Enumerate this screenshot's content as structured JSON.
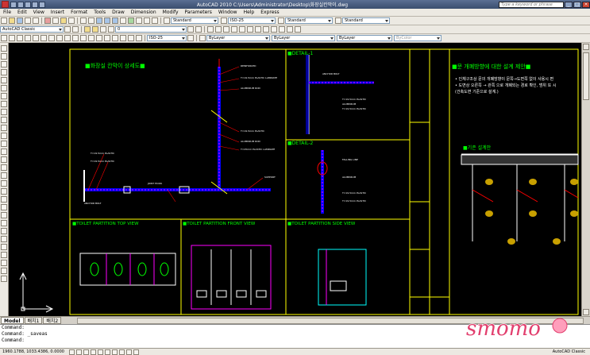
{
  "window": {
    "title": "AutoCAD 2010  C:\\Users\\Administrator\\Desktop\\화장실칸막이.dwg",
    "search_placeholder": "Type a keyword or phrase"
  },
  "menu": [
    "File",
    "Edit",
    "View",
    "Insert",
    "Format",
    "Tools",
    "Draw",
    "Dimension",
    "Modify",
    "Parameters",
    "Window",
    "Help",
    "Express"
  ],
  "toolbar1": {
    "textstyle": "Standard",
    "dimstyle": "ISO-25",
    "tablestyle": "Standard",
    "mleaderstyle": "Standard"
  },
  "toolbar2": {
    "workspace": "AutoCAD Classic",
    "layer": "0"
  },
  "toolbar3": {
    "dimstyle2": "ISO-25",
    "color": "ByLayer",
    "linetype": "ByLayer",
    "lineweight": "ByLayer",
    "plotstyle": "ByColor"
  },
  "drawing": {
    "main_title": "■화장실 칸막이 상세도■",
    "detail1": "■DETAIL-1",
    "detail2": "■DETAIL-2",
    "top_view": "■TOILET PARTITION TOP VIEW",
    "front_view": "■TOILET PARTITION FRONT VIEW",
    "side_view": "■TOILET PARTITION SIDE VIEW",
    "right_title": "■문 개폐방향에 대한 설계 제안■",
    "right_note1": "• 인체구조상 문의 개폐방향이 문쪽→도면쪽 없이 사용시 편",
    "right_note2": "• 도면상 오른쪽 → 관쪽 으로 개폐되는 경로 확인, 범위 또 시",
    "right_note3": "  (건축도면 기준으로 설계.)",
    "right_sub": "■기존 설계안"
  },
  "tabs": [
    "Model",
    "배치1",
    "배치2"
  ],
  "active_tab": "Model",
  "command": {
    "line1": "Command:",
    "line2": "Command:  _saveas",
    "line3": "Command:"
  },
  "status": {
    "coords": "1960.1788, 1033.4386, 0.0000",
    "right": "AutoCAD Classic"
  },
  "watermark": "smomo"
}
